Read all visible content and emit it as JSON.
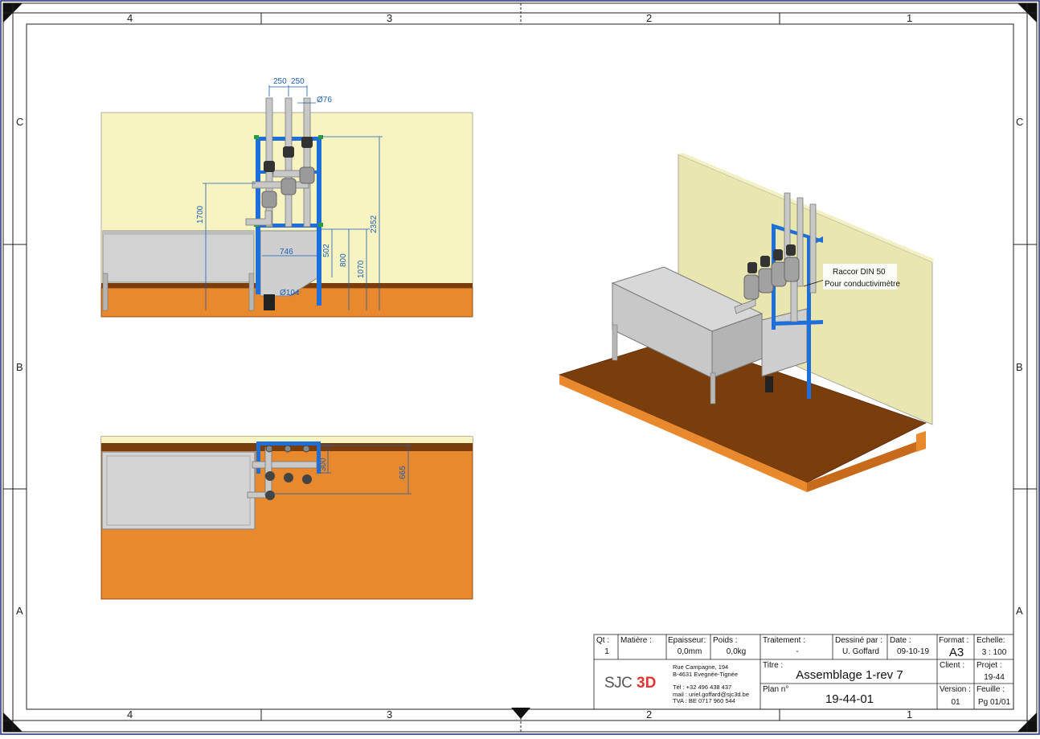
{
  "frame": {
    "columns_top": [
      "4",
      "3",
      "2",
      "1"
    ],
    "columns_bottom": [
      "4",
      "3",
      "2",
      "1"
    ],
    "rows_left": [
      "C",
      "B",
      "A"
    ],
    "rows_right": [
      "C",
      "B",
      "A"
    ]
  },
  "front_view": {
    "dims": {
      "d250a": "250",
      "d250b": "250",
      "d76": "Ø76",
      "d1700": "1700",
      "d2352": "2352",
      "d746": "746",
      "d502": "502",
      "d800": "800",
      "d1070": "1070",
      "d104": "Ø104"
    }
  },
  "top_view": {
    "dims": {
      "d300": "300",
      "d665": "665"
    }
  },
  "iso_view": {
    "callout_line1": "Raccor DIN 50",
    "callout_line2": "Pour conductivimètre"
  },
  "title_block": {
    "qt_label": "Qt :",
    "qt_value": "1",
    "matiere_label": "Matière :",
    "matiere_value": "",
    "epaisseur_label": "Epaisseur:",
    "epaisseur_value": "0,0mm",
    "poids_label": "Poids :",
    "poids_value": "0,0kg",
    "traitement_label": "Traitement :",
    "traitement_value": "-",
    "dessine_label": "Dessiné par :",
    "dessine_value": "U. Goffard",
    "date_label": "Date :",
    "date_value": "09-10-19",
    "format_label": "Format :",
    "format_value": "A3",
    "echelle_label": "Echelle:",
    "echelle_value": "3 : 100",
    "titre_label": "Titre :",
    "titre_value": "Assemblage 1-rev 7",
    "client_label": "Client :",
    "client_value": "",
    "projet_label": "Projet :",
    "projet_value": "19-44",
    "plan_label": "Plan n°",
    "plan_value": "19-44-01",
    "version_label": "Version :",
    "version_value": "01",
    "feuille_label": "Feuille :",
    "feuille_value": "Pg  01/01",
    "logo_text": "SJC3D",
    "address": [
      "Rue Campagne, 194",
      "B-4631 Evegnée-Tignée",
      "",
      "Tél : +32 496 438 437",
      "mail : uriel.goffard@sjc3d.be",
      "TVA : BE 0717 960 544"
    ]
  },
  "colors": {
    "wall": "#f7f4c2",
    "floor": "#e8892e",
    "floor_dark": "#7a3d0c",
    "frame": "#1e6fd9",
    "tank": "#cfcfcf",
    "dim": "#1a5fb4"
  }
}
